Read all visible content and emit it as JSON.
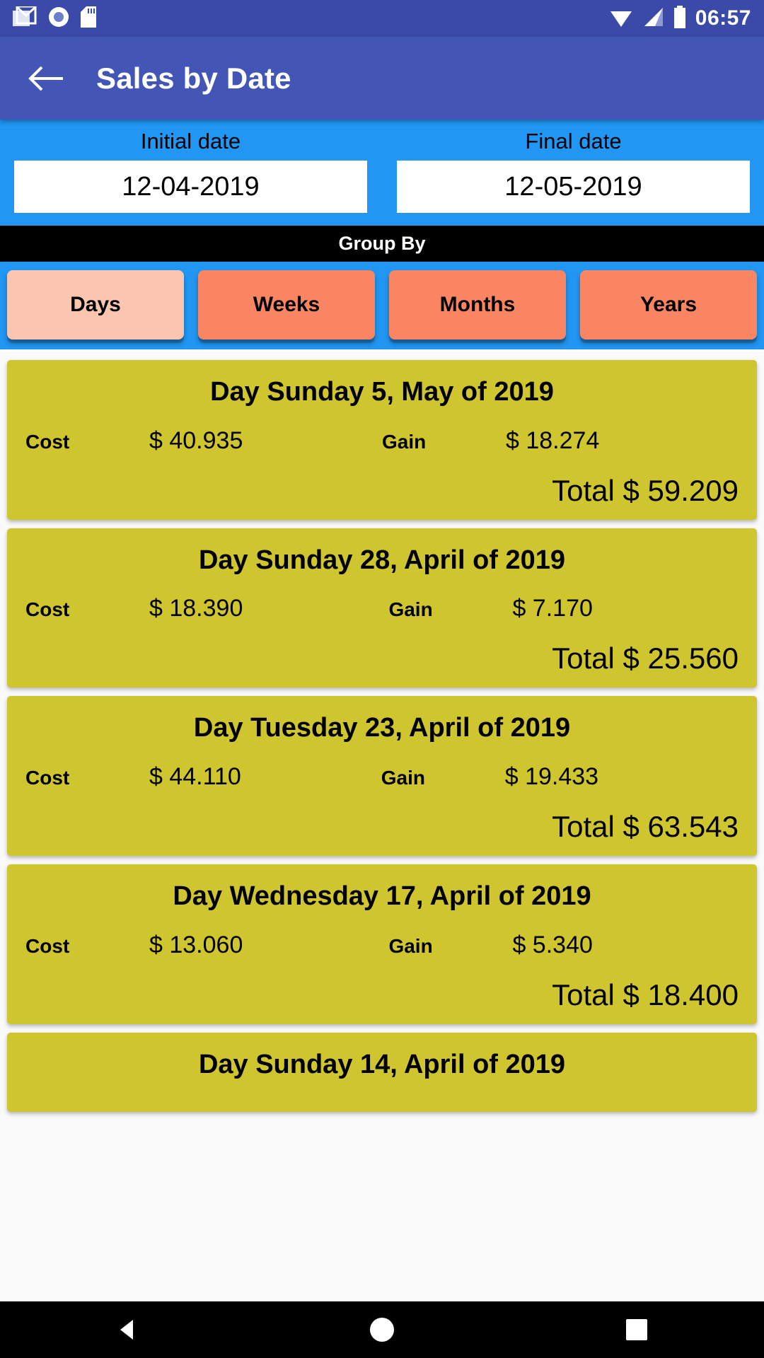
{
  "status_bar": {
    "clock": "06:57",
    "icons": [
      "gmail-icon",
      "record-icon",
      "sdcard-icon",
      "wifi-icon",
      "signal-icon",
      "battery-icon"
    ]
  },
  "app_bar": {
    "back_label": "back-arrow",
    "title": "Sales by Date"
  },
  "date_panel": {
    "initial": {
      "label": "Initial date",
      "value": "12-04-2019"
    },
    "final": {
      "label": "Final date",
      "value": "12-05-2019"
    }
  },
  "group_by": {
    "header": "Group By",
    "selected": "Days",
    "tabs": [
      {
        "label": "Days",
        "selected": true
      },
      {
        "label": "Weeks",
        "selected": false
      },
      {
        "label": "Months",
        "selected": false
      },
      {
        "label": "Years",
        "selected": false
      }
    ]
  },
  "list": {
    "cost_label": "Cost",
    "gain_label": "Gain",
    "total_prefix": "Total",
    "items": [
      {
        "title": "Day Sunday 5, May of 2019",
        "cost": "$ 40.935",
        "gain": "$ 18.274",
        "total": "Total $ 59.209"
      },
      {
        "title": "Day Sunday 28, April of 2019",
        "cost": "$ 18.390",
        "gain": "$ 7.170",
        "total": "Total $ 25.560"
      },
      {
        "title": "Day Tuesday 23, April of 2019",
        "cost": "$ 44.110",
        "gain": "$ 19.433",
        "total": "Total $ 63.543"
      },
      {
        "title": "Day Wednesday 17, April of 2019",
        "cost": "$ 13.060",
        "gain": "$ 5.340",
        "total": "Total $ 18.400"
      },
      {
        "title": "Day Sunday 14, April of 2019",
        "cost": "",
        "gain": "",
        "total": ""
      }
    ]
  },
  "nav_bar": {
    "back": "nav-back-triangle",
    "home": "nav-home-circle",
    "recents": "nav-recents-square"
  },
  "colors": {
    "status_bar": "#3b4aa8",
    "app_bar": "#4355b5",
    "date_panel": "#2196f3",
    "group_bar": "#000000",
    "tab": "#fa8562",
    "tab_selected": "#fbc6b0",
    "card": "#cfc52e",
    "page_bg": "#fafafa"
  }
}
